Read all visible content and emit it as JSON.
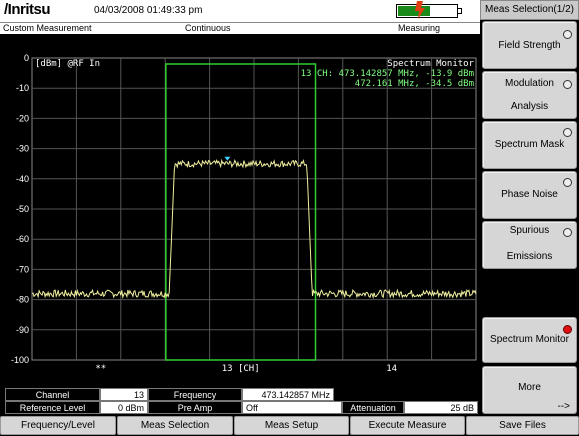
{
  "header": {
    "logo_text": "/Inritsu",
    "datetime": "04/03/2008 01:49:33 pm",
    "battery_level": 0.55,
    "battery_color": "#1a8a1a",
    "status_left": "Custom Measurement",
    "status_mid": "Continuous",
    "status_right": "Measuring"
  },
  "plot": {
    "units_label": "[dBm]",
    "input_label": "@RF In",
    "mode_title": "Spectrum Monitor",
    "marker_line1": "13 CH: 473.142857 MHz,  -13.9 dBm",
    "marker_line2": "472.161 MHz,  -34.5 dBm",
    "channel_left_label": "**",
    "channel_center_label": "13 [CH]",
    "channel_right_label": "14",
    "trace_color": "#f0f0a0",
    "window_color": "#30d030",
    "marker_color": "#40d0ff",
    "text_color": "#80ff80"
  },
  "chart_data": {
    "type": "line",
    "ylabel": "[dBm]",
    "ylim": [
      -100,
      0
    ],
    "yticks": [
      "0",
      "-10",
      "-20",
      "-30",
      "-40",
      "-50",
      "-60",
      "-70",
      "-80",
      "-90",
      "-100"
    ],
    "grid": true,
    "series": [
      {
        "values_note": "noise floor / channel plateau",
        "floor_dbm": -78,
        "channel_power_dbm": -35,
        "channel_start_fraction": 0.315,
        "channel_end_fraction": 0.625
      }
    ]
  },
  "params": {
    "channel_label": "Channel",
    "channel_value": "13",
    "frequency_label": "Frequency",
    "frequency_value": "473.142857 MHz",
    "reflevel_label": "Reference Level",
    "reflevel_value": "0 dBm",
    "preamp_label": "Pre Amp",
    "preamp_value": "Off",
    "atten_label": "Attenuation",
    "atten_value": "25 dB"
  },
  "menu": {
    "title": "Meas Selection(1/2)",
    "items": [
      {
        "line1": "Field Strength",
        "line2": "",
        "selected": false
      },
      {
        "line1": "Modulation",
        "line2": "Analysis",
        "selected": false
      },
      {
        "line1": "Spectrum Mask",
        "line2": "",
        "selected": false
      },
      {
        "line1": "Phase Noise",
        "line2": "",
        "selected": false
      },
      {
        "line1": "Spurious",
        "line2": "Emissions",
        "selected": false
      },
      {
        "line1": "Spectrum Monitor",
        "line2": "",
        "selected": true
      },
      {
        "line1": "More",
        "line2": "-->",
        "selected": false
      }
    ]
  },
  "bottom": {
    "keys": [
      "Frequency/Level",
      "Meas Selection",
      "Meas Setup",
      "Execute Measure",
      "Save Files"
    ]
  }
}
